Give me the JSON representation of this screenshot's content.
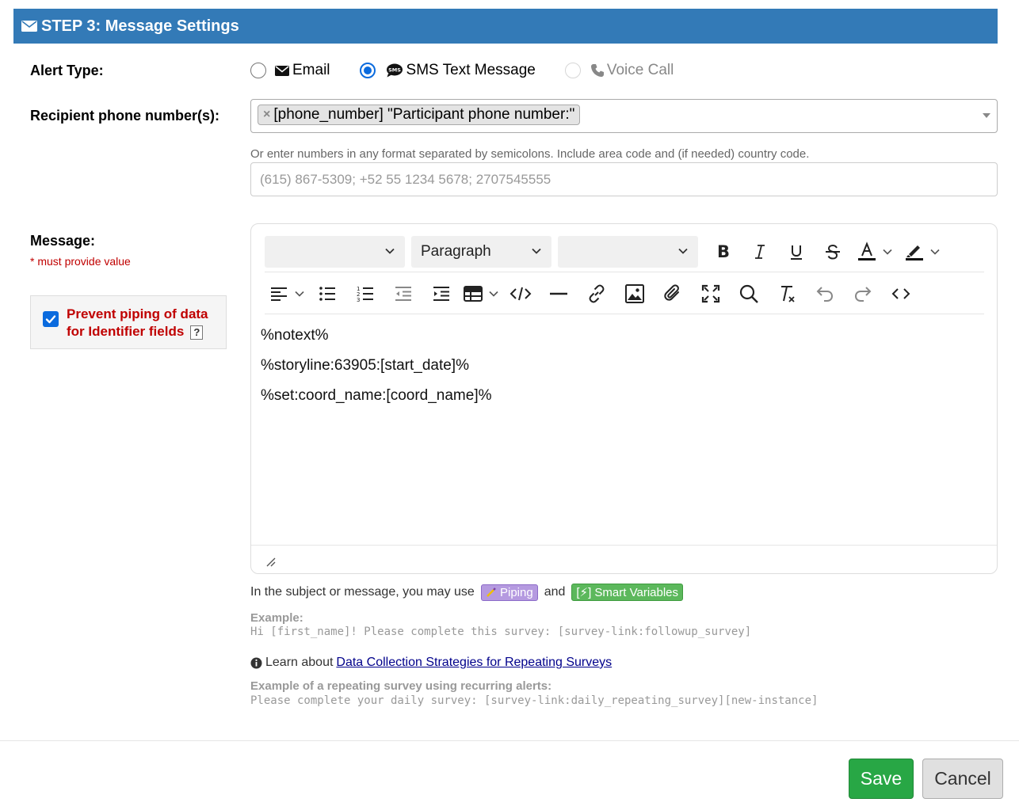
{
  "header": {
    "title": "STEP 3: Message Settings",
    "icon": "envelope-icon"
  },
  "alert_type": {
    "label": "Alert Type:",
    "options": [
      {
        "label": "Email",
        "icon": "envelope-icon",
        "selected": false,
        "disabled": false
      },
      {
        "label": "SMS Text Message",
        "icon": "sms-bubble-icon",
        "selected": true,
        "disabled": false
      },
      {
        "label": "Voice Call",
        "icon": "phone-icon",
        "selected": false,
        "disabled": true
      }
    ]
  },
  "recipient": {
    "label": "Recipient phone number(s):",
    "chip": "[phone_number] \"Participant phone number:\"",
    "chip_remove": "×",
    "hint": "Or enter numbers in any format separated by semicolons. Include area code and (if needed) country code.",
    "placeholder": "(615) 867-5309; +52 55 1234 5678; 2707545555"
  },
  "message": {
    "label": "Message:",
    "required_note": "* must provide value",
    "prevent_piping": {
      "line1": "Prevent piping of data",
      "line2": "for Identifier fields",
      "help": "?",
      "checked": true
    },
    "editor": {
      "block_format": "Paragraph",
      "lines": [
        "%notext%",
        "%storyline:63905:[start_date]%",
        "%set:coord_name:[coord_name]%"
      ]
    }
  },
  "help": {
    "piping_prefix": "In the subject or message, you may use",
    "piping_badge": "Piping",
    "and": "and",
    "smart_badge": "[⚡] Smart Variables",
    "example_title": "Example:",
    "example_body": "Hi [first_name]! Please complete this survey: [survey-link:followup_survey]",
    "learn_prefix": "Learn about",
    "learn_link": "Data Collection Strategies for Repeating Surveys",
    "example2_title": "Example of a repeating survey using recurring alerts:",
    "example2_body": "Please complete your daily survey: [survey-link:daily_repeating_survey][new-instance]"
  },
  "footer": {
    "save": "Save",
    "cancel": "Cancel"
  },
  "colors": {
    "header_bg": "#337ab7",
    "required": "#c00000",
    "save_bg": "#28a745",
    "radio_accent": "#0b6bde"
  }
}
